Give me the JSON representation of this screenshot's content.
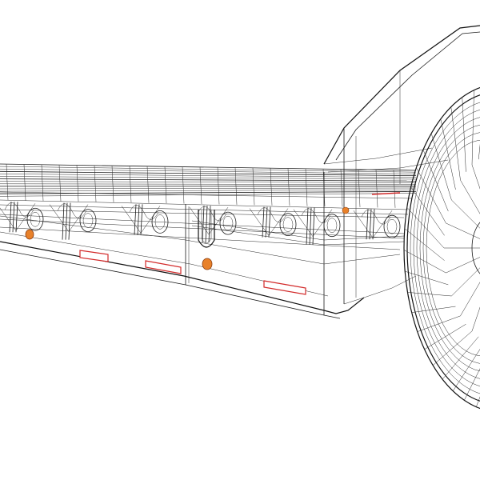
{
  "scene": {
    "subject": "wireframe-render",
    "background_color": "#ffffff",
    "line_color": "#1a1a1a",
    "accent_colors": {
      "side_marker_lamp": "#e8812a",
      "reflector_strip": "#d22a2a"
    },
    "counts": {
      "deck_rails": 14,
      "marker_lamps": 3,
      "reflector_strips": 3
    }
  }
}
